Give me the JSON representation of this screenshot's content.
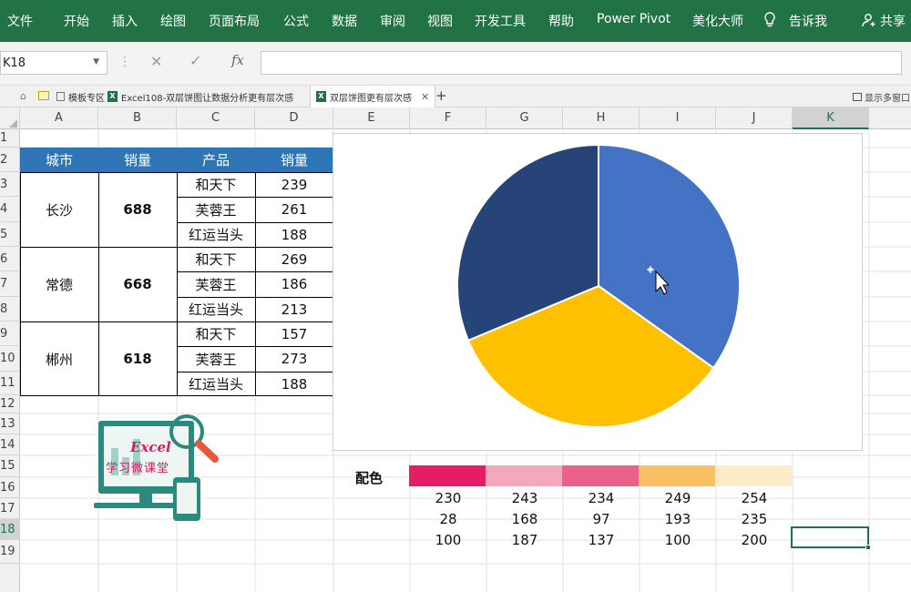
{
  "ribbon": {
    "menu": [
      "文件",
      "开始",
      "插入",
      "绘图",
      "页面布局",
      "公式",
      "数据",
      "审阅",
      "视图",
      "开发工具",
      "帮助",
      "Power Pivot",
      "美化大师"
    ],
    "tell_me": "告诉我",
    "share": "共享"
  },
  "formula_bar": {
    "name_box": "K18",
    "fx": "fx",
    "formula": ""
  },
  "workbook_tabs": {
    "templates": "模板专区",
    "tab1": "Excel108-双层饼图让数据分析更有层次感",
    "tab2": "双层饼图更有层次感",
    "show_windows": "显示多窗口"
  },
  "grid": {
    "columns": [
      "A",
      "B",
      "C",
      "D",
      "E",
      "F",
      "G",
      "H",
      "I",
      "J",
      "K"
    ],
    "rows": [
      "1",
      "2",
      "3",
      "4",
      "5",
      "6",
      "7",
      "8",
      "9",
      "10",
      "11",
      "12",
      "13",
      "14",
      "15",
      "16",
      "17",
      "18",
      "19"
    ],
    "selected_column": "K",
    "selected_row": "18"
  },
  "table": {
    "headers": [
      "城市",
      "销量",
      "产品",
      "销量"
    ],
    "groups": [
      {
        "city": "长沙",
        "total": "688",
        "items": [
          {
            "product": "和天下",
            "sales": "239"
          },
          {
            "product": "芙蓉王",
            "sales": "261"
          },
          {
            "product": "红运当头",
            "sales": "188"
          }
        ]
      },
      {
        "city": "常德",
        "total": "668",
        "items": [
          {
            "product": "和天下",
            "sales": "269"
          },
          {
            "product": "芙蓉王",
            "sales": "186"
          },
          {
            "product": "红运当头",
            "sales": "213"
          }
        ]
      },
      {
        "city": "郴州",
        "total": "618",
        "items": [
          {
            "product": "和天下",
            "sales": "157"
          },
          {
            "product": "芙蓉王",
            "sales": "273"
          },
          {
            "product": "红运当头",
            "sales": "188"
          }
        ]
      }
    ]
  },
  "chart_data": {
    "type": "pie",
    "categories": [
      "长沙",
      "常德",
      "郴州"
    ],
    "values": [
      688,
      668,
      618
    ],
    "colors": [
      "#4472c4",
      "#ffc000",
      "#264478"
    ]
  },
  "palette": {
    "label": "配色",
    "swatches": [
      {
        "color": "#e61c64",
        "r": "230",
        "g": "28",
        "b": "100"
      },
      {
        "color": "#f3a8bb",
        "r": "243",
        "g": "168",
        "b": "187"
      },
      {
        "color": "#ea6189",
        "r": "234",
        "g": "97",
        "b": "137"
      },
      {
        "color": "#f9c164",
        "r": "249",
        "g": "193",
        "b": "100"
      },
      {
        "color": "#feebc8",
        "r": "254",
        "g": "235",
        "b": "200"
      }
    ]
  },
  "logo": {
    "text": "Excel",
    "subtitle": "学习微课堂"
  },
  "colors": {
    "ribbon_green": "#217346",
    "table_header_blue": "#2e75b6"
  }
}
